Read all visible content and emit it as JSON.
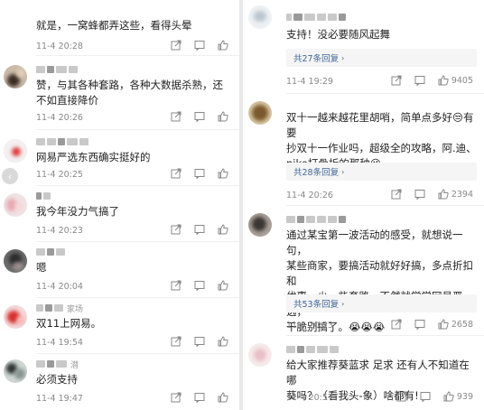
{
  "left": {
    "comments": [
      {
        "text": "就是，一窝蜂都弄这些，看得头晕",
        "time": "11-4 20:28",
        "name_hint": ""
      },
      {
        "text": "赞，与其各种套路，各种大数据杀熟，还不如直接降价",
        "time": "11-4 20:26",
        "name_hint": ""
      },
      {
        "text": "网易严选东西确实挺好的",
        "time": "11-4 20:25",
        "name_hint": ""
      },
      {
        "text": "我今年没力气搞了",
        "time": "11-4 20:23",
        "name_hint": ""
      },
      {
        "text": "嗯",
        "time": "11-4 20:04",
        "name_hint": ""
      },
      {
        "text": "双11上网易。",
        "time": "11-4 19:54",
        "name_hint": "家场"
      },
      {
        "text": "必须支持",
        "time": "11-4 19:47",
        "name_hint": "潜"
      }
    ]
  },
  "right": {
    "comments": [
      {
        "text": "支持！没必要随风起舞",
        "replies": "共27条回复",
        "time": "11-4 19:29",
        "likes": "9405"
      },
      {
        "text_line1": "双十一越来越花里胡哨，简单点多好",
        "emoji1": "😒",
        "text_line1b": "有要",
        "text_line2": "抄双十一作业吗，超级全的攻略，阿.迪、",
        "text_line3": "nike打骨折的那种",
        "emoji2": "😜",
        "replies": "共28条回复",
        "time": "11-4 20:26",
        "likes": "2394"
      },
      {
        "text_line1": "通过某宝第一波活动的感受，就想说一句，",
        "text_line2": "某些商家，要搞活动就好好搞，多点折扣和",
        "text_line3": "优惠，少一些套路。不然就学学网易严选，",
        "text_line4": "干脆别搞了。",
        "emoji": "😭😭😭",
        "replies": "共53条回复",
        "time": "11-4 20:23",
        "likes": "2658"
      },
      {
        "text_line1": "给大家推荐葵蓝求 足求 还有人不知道在哪",
        "text_line2": "葵吗？（看我头-象）啥都有!",
        "time": "11-4 20:57",
        "likes": "939"
      }
    ]
  },
  "colors": {
    "link": "#406599",
    "meta": "#888888",
    "reply_bg": "#f5f5f5",
    "divider": "#e9e9e9"
  }
}
